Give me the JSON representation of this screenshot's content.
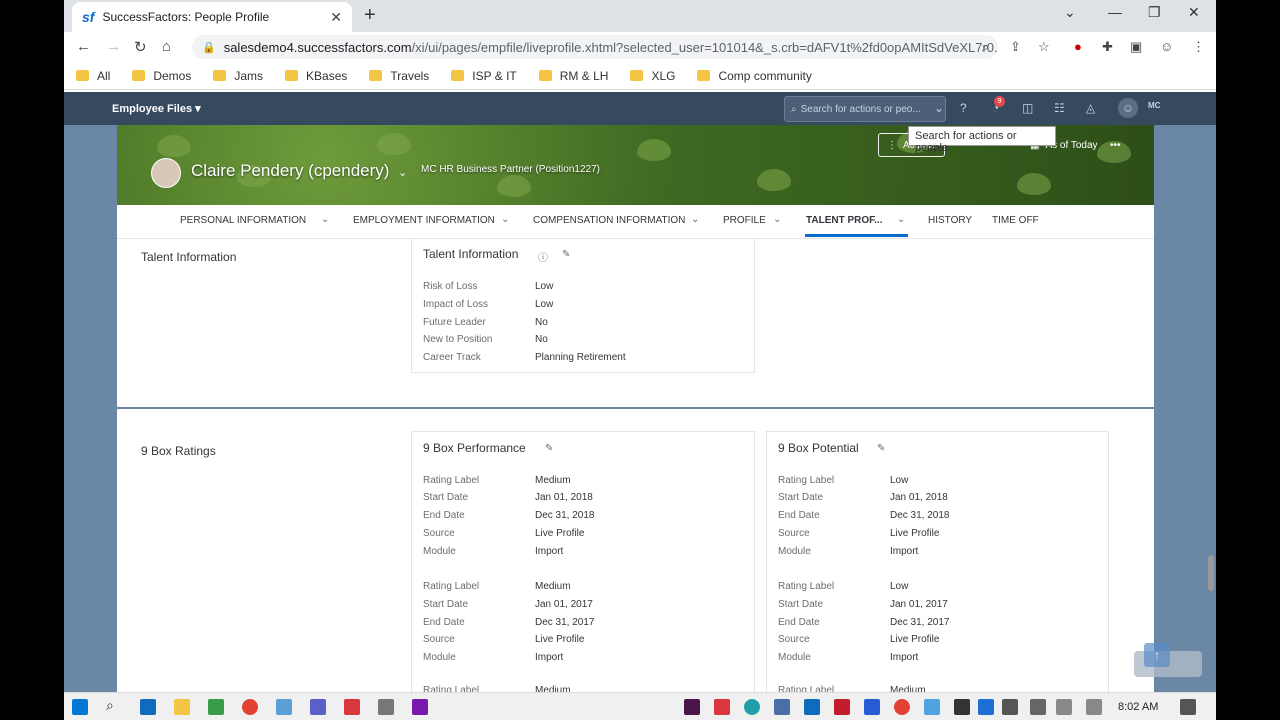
{
  "browser": {
    "tab_title": "SuccessFactors: People Profile",
    "favicon": "sf",
    "url_host": "salesdemo4.successfactors.com",
    "url_path": "/xi/ui/pages/empfile/liveprofile.xhtml?selected_user=101014&_s.crb=dAFV1t%2fd0opAMItSdVeXL7r0...",
    "bookmarks": [
      "All",
      "Demos",
      "Jams",
      "KBases",
      "Travels",
      "ISP & IT",
      "RM & LH",
      "XLG",
      "Comp community"
    ]
  },
  "shell": {
    "title": "Employee Files",
    "search_placeholder": "Search for actions or peo...",
    "tooltip": "Search for actions or people",
    "notification_count": "9",
    "user_initials": "MC"
  },
  "header": {
    "employee_name": "Claire Pendery (cpendery)",
    "position": "MC HR Business Partner (Position1227)",
    "actions_label": "Actions",
    "as_of_label": "As of Today"
  },
  "tabs": [
    "PERSONAL INFORMATION",
    "EMPLOYMENT INFORMATION",
    "COMPENSATION INFORMATION",
    "PROFILE",
    "TALENT PROF...",
    "HISTORY",
    "TIME OFF"
  ],
  "talent": {
    "section_title": "Talent Information",
    "card_title": "Talent Information",
    "rows": [
      {
        "label": "Risk of Loss",
        "value": "Low"
      },
      {
        "label": "Impact of Loss",
        "value": "Low"
      },
      {
        "label": "Future Leader",
        "value": "No"
      },
      {
        "label": "New to Position",
        "value": "No"
      },
      {
        "label": "Career Track",
        "value": "Planning Retirement"
      }
    ]
  },
  "ninebox": {
    "section_title": "9 Box Ratings",
    "performance": {
      "title": "9 Box Performance",
      "rows": [
        {
          "label": "Rating Label",
          "value": "Medium"
        },
        {
          "label": "Start Date",
          "value": "Jan 01, 2018"
        },
        {
          "label": "End Date",
          "value": "Dec 31, 2018"
        },
        {
          "label": "Source",
          "value": "Live Profile"
        },
        {
          "label": "Module",
          "value": "Import"
        },
        {
          "label": "Rating Label",
          "value": "Medium"
        },
        {
          "label": "Start Date",
          "value": "Jan 01, 2017"
        },
        {
          "label": "End Date",
          "value": "Dec 31, 2017"
        },
        {
          "label": "Source",
          "value": "Live Profile"
        },
        {
          "label": "Module",
          "value": "Import"
        },
        {
          "label": "Rating Label",
          "value": "Medium"
        }
      ]
    },
    "potential": {
      "title": "9 Box Potential",
      "rows": [
        {
          "label": "Rating Label",
          "value": "Low"
        },
        {
          "label": "Start Date",
          "value": "Jan 01, 2018"
        },
        {
          "label": "End Date",
          "value": "Dec 31, 2018"
        },
        {
          "label": "Source",
          "value": "Live Profile"
        },
        {
          "label": "Module",
          "value": "Import"
        },
        {
          "label": "Rating Label",
          "value": "Low"
        },
        {
          "label": "Start Date",
          "value": "Jan 01, 2017"
        },
        {
          "label": "End Date",
          "value": "Dec 31, 2017"
        },
        {
          "label": "Source",
          "value": "Live Profile"
        },
        {
          "label": "Module",
          "value": "Import"
        },
        {
          "label": "Rating Label",
          "value": "Medium"
        }
      ]
    }
  },
  "taskbar": {
    "time": "8:02 AM"
  }
}
